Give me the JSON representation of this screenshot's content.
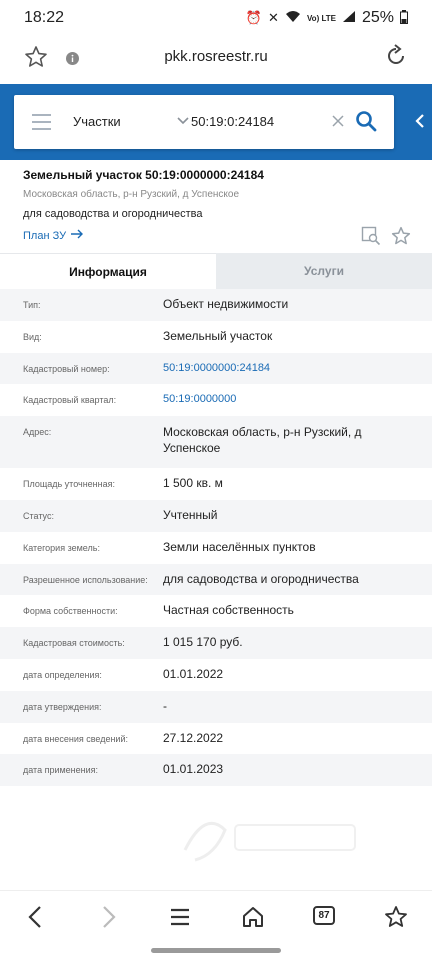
{
  "status_bar": {
    "time": "18:22",
    "network": "Vo) LTE",
    "battery": "25%"
  },
  "browser": {
    "url": "pkk.rosreestr.ru"
  },
  "search": {
    "layer": "Участки",
    "query": "50:19:0:24184"
  },
  "object": {
    "title": "Земельный участок  50:19:0000000:24184",
    "address": "Московская область, р-н Рузский, д Успенское",
    "use": "для садоводства и огородничества",
    "plan_link": "План ЗУ"
  },
  "tabs": [
    {
      "label": "Информация"
    },
    {
      "label": "Услуги"
    }
  ],
  "rows": [
    {
      "label": "Тип:",
      "value": "Объект недвижимости"
    },
    {
      "label": "Вид:",
      "value": "Земельный участок"
    },
    {
      "label": "Кадастровый номер:",
      "value": "50:19:0000000:24184"
    },
    {
      "label": "Кадастровый квартал:",
      "value": "50:19:0000000"
    },
    {
      "label": "Адрес:",
      "value": "Московская область, р-н Рузский, д Успенское"
    },
    {
      "label": "Площадь уточненная:",
      "value": "1 500 кв. м"
    },
    {
      "label": "Статус:",
      "value": "Учтенный"
    },
    {
      "label": "Категория земель:",
      "value": "Земли населённых пунктов"
    },
    {
      "label": "Разрешенное использование:",
      "value": "для садоводства и огородничества"
    },
    {
      "label": "Форма собственности:",
      "value": "Частная собственность"
    },
    {
      "label": "Кадастровая стоимость:",
      "value": "1 015 170 руб."
    },
    {
      "label": "дата определения:",
      "value": "01.01.2022"
    },
    {
      "label": "дата утверждения:",
      "value": "-"
    },
    {
      "label": "дата внесения сведений:",
      "value": "27.12.2022"
    },
    {
      "label": "дата применения:",
      "value": "01.01.2023"
    }
  ],
  "nav": {
    "tabs_count": "87"
  },
  "colors": {
    "accent": "#1a6bb5",
    "alt_row": "#f4f5f7",
    "inactive_tab": "#e9ecef"
  },
  "icons": [
    "bookmark-star-icon",
    "info-icon",
    "reload-icon",
    "menu-icon",
    "chevron-down-icon",
    "clear-icon",
    "search-icon",
    "collapse-chevron-icon",
    "arrow-right-icon",
    "map-search-icon",
    "favorite-star-icon",
    "back-icon",
    "forward-icon",
    "menu-lines-icon",
    "home-icon",
    "tabs-icon",
    "bookmarks-icon"
  ]
}
